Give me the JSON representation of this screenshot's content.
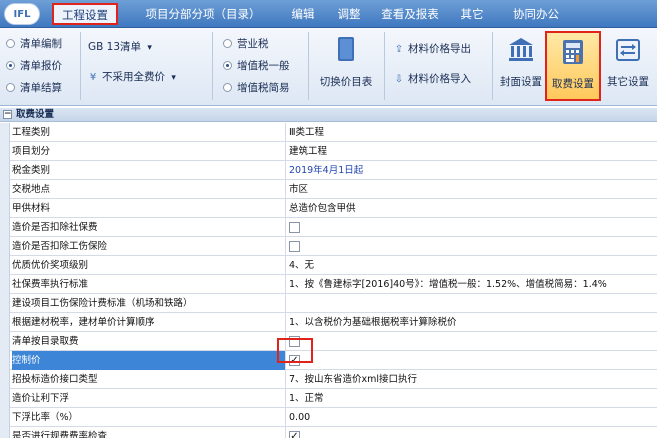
{
  "app": {
    "logo_text": "IFL"
  },
  "menu": [
    {
      "label": "工程设置",
      "active": true
    },
    {
      "label": "项目分部分项（目录）"
    },
    {
      "label": "编辑"
    },
    {
      "label": "调整"
    },
    {
      "label": "查看及报表"
    },
    {
      "label": "其它"
    },
    {
      "label": "协同办公"
    }
  ],
  "ribbon": {
    "bill_mode": [
      "清单编制",
      "清单报价",
      "清单结算"
    ],
    "bill_mode_selected": "清单报价",
    "standard_select": "GB 13清单",
    "fee_select": "不采用全费价",
    "tax_mode": [
      "营业税",
      "增值税一般",
      "增值税简易"
    ],
    "tax_mode_selected": "增值税一般",
    "switch_price_catalog": "切换价目表",
    "export_material_price": "材料价格导出",
    "import_material_price": "材料价格导入",
    "cover_settings": "封面设置",
    "fee_settings": "取费设置",
    "other_settings": "其它设置"
  },
  "panel": {
    "title": "取费设置",
    "rows": [
      {
        "name": "工程类别",
        "value": "Ⅲ类工程"
      },
      {
        "name": "项目划分",
        "value": "建筑工程"
      },
      {
        "name": "税金类别",
        "value": "2019年4月1日起",
        "blue": true
      },
      {
        "name": "交税地点",
        "value": "市区"
      },
      {
        "name": "甲供材料",
        "value": "总造价包含甲供"
      },
      {
        "name": "造价是否扣除社保费",
        "checkbox": true,
        "checked": false
      },
      {
        "name": "造价是否扣除工伤保险",
        "checkbox": true,
        "checked": false
      },
      {
        "name": "优质优价奖项级别",
        "value": "4、无"
      },
      {
        "name": "社保费率执行标准",
        "value": "1、按《鲁建标字[2016]40号》：增值税一般：1.52%、增值税简易：1.4%"
      },
      {
        "name": "建设项目工伤保险计费标准（机场和铁路）",
        "value": ""
      },
      {
        "name": "根据建材税率，建材单价计算顺序",
        "value": "1、以含税价为基础根据税率计算除税价"
      },
      {
        "name": "清单按目录取费",
        "checkbox": true,
        "checked": false
      },
      {
        "name": "控制价",
        "checkbox": true,
        "checked": true,
        "selected": true
      },
      {
        "name": "招投标造价接口类型",
        "value": "7、按山东省造价xml接口执行"
      },
      {
        "name": "造价让利下浮",
        "value": "1、正常"
      },
      {
        "name": "下浮比率（%）",
        "value": "0.00"
      },
      {
        "name": "是否进行规费费率检查",
        "checkbox": true,
        "checked": true
      }
    ]
  },
  "colors": {
    "menu_bg": "#4f86c9",
    "highlight_red": "#e0241b",
    "selected_row": "#3d85d6",
    "active_button": "#ffc95b"
  },
  "icons": {
    "check_mark": "✓",
    "collapse_box": "−",
    "dropdown": "▾",
    "currency": "¥",
    "upload": "⇪"
  }
}
